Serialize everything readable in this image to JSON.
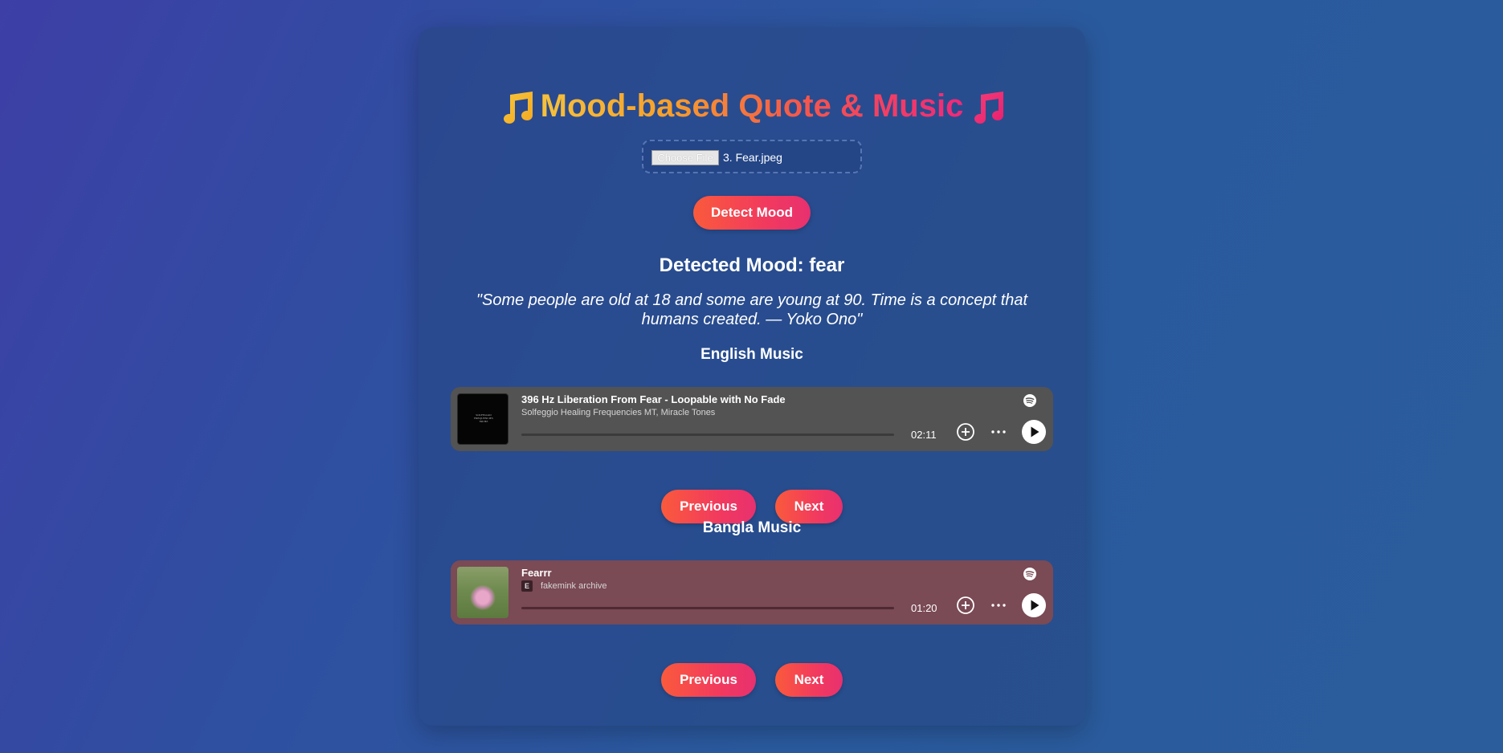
{
  "header": {
    "title": "Mood-based Quote & Music"
  },
  "upload": {
    "button_label": "Choose File",
    "file_name": "3. Fear.jpeg"
  },
  "detect_button": "Detect Mood",
  "result": {
    "mood_text": "Detected Mood: fear",
    "quote": "\"Some people are old at 18 and some are young at 90. Time is a concept that humans created. — Yoko Ono\""
  },
  "english": {
    "heading": "English Music",
    "track": {
      "title": "396 Hz Liberation From Fear - Loopable with No Fade",
      "artist": "Solfeggio Healing Frequencies MT, Miracle Tones",
      "duration": "02:11"
    },
    "prev_label": "Previous",
    "next_label": "Next"
  },
  "bangla": {
    "heading": "Bangla Music",
    "track": {
      "title": "Fearrr",
      "explicit_badge": "E",
      "artist": "fakemink archive",
      "duration": "01:20"
    },
    "prev_label": "Previous",
    "next_label": "Next"
  },
  "colors": {
    "button_gradient_start": "#fa5a3c",
    "button_gradient_end": "#e8306f",
    "english_player_bg": "#535353",
    "bangla_player_bg": "#7a4a55"
  },
  "icons": {
    "title_left": "music-note-icon",
    "title_right": "music-note-icon",
    "player_logo": "spotify-icon",
    "add": "add-circle-icon",
    "more": "more-dots-icon",
    "play": "play-icon"
  }
}
